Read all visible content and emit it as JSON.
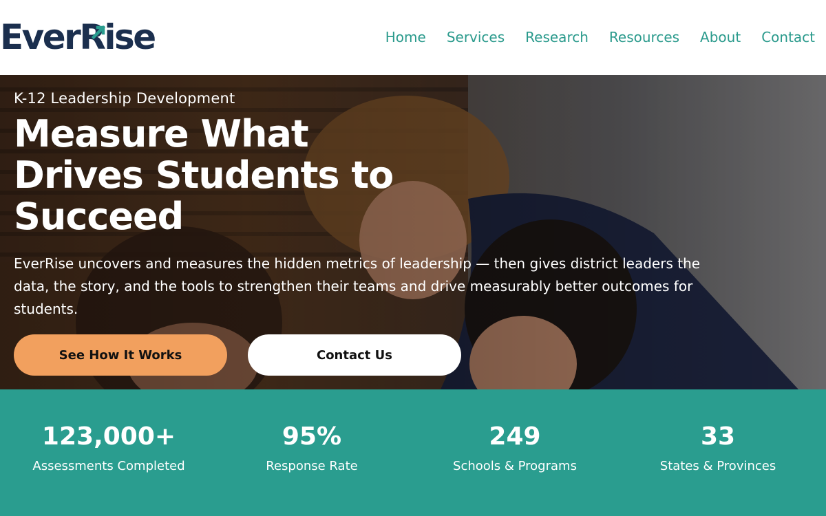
{
  "brand": {
    "logo_part1": "Ever",
    "logo_part2": "Rise",
    "colors": {
      "navy": "#1b2f4e",
      "teal": "#2a9d8f",
      "orange": "#f2a05e"
    }
  },
  "nav": {
    "items": [
      {
        "label": "Home"
      },
      {
        "label": "Services"
      },
      {
        "label": "Research"
      },
      {
        "label": "Resources"
      },
      {
        "label": "About"
      },
      {
        "label": "Contact"
      }
    ]
  },
  "hero": {
    "eyebrow": "K-12 Leadership Development",
    "title": "Measure What Drives Students to Succeed",
    "description": "EverRise uncovers and measures the hidden metrics of leadership — then gives district leaders the data, the story, and the tools to strengthen their teams and drive measurably better outcomes for students.",
    "primary_button": "See How It Works",
    "secondary_button": "Contact Us"
  },
  "stats": [
    {
      "value": "123,000+",
      "label": "Assessments Completed"
    },
    {
      "value": "95%",
      "label": "Response Rate"
    },
    {
      "value": "249",
      "label": "Schools & Programs"
    },
    {
      "value": "33",
      "label": "States & Provinces"
    }
  ]
}
